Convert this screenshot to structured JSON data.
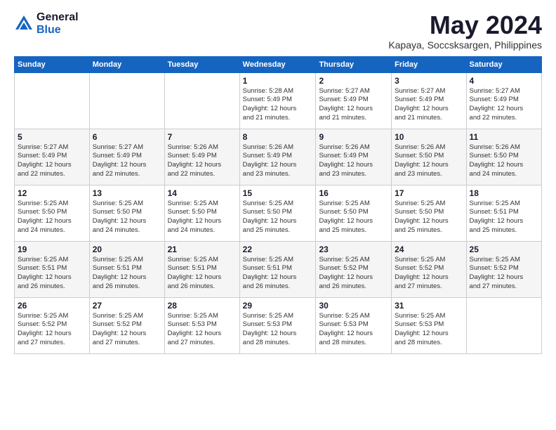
{
  "logo": {
    "general": "General",
    "blue": "Blue"
  },
  "header": {
    "title": "May 2024",
    "subtitle": "Kapaya, Soccsksargen, Philippines"
  },
  "weekdays": [
    "Sunday",
    "Monday",
    "Tuesday",
    "Wednesday",
    "Thursday",
    "Friday",
    "Saturday"
  ],
  "weeks": [
    [
      {
        "day": "",
        "info": ""
      },
      {
        "day": "",
        "info": ""
      },
      {
        "day": "",
        "info": ""
      },
      {
        "day": "1",
        "info": "Sunrise: 5:28 AM\nSunset: 5:49 PM\nDaylight: 12 hours\nand 21 minutes."
      },
      {
        "day": "2",
        "info": "Sunrise: 5:27 AM\nSunset: 5:49 PM\nDaylight: 12 hours\nand 21 minutes."
      },
      {
        "day": "3",
        "info": "Sunrise: 5:27 AM\nSunset: 5:49 PM\nDaylight: 12 hours\nand 21 minutes."
      },
      {
        "day": "4",
        "info": "Sunrise: 5:27 AM\nSunset: 5:49 PM\nDaylight: 12 hours\nand 22 minutes."
      }
    ],
    [
      {
        "day": "5",
        "info": "Sunrise: 5:27 AM\nSunset: 5:49 PM\nDaylight: 12 hours\nand 22 minutes."
      },
      {
        "day": "6",
        "info": "Sunrise: 5:27 AM\nSunset: 5:49 PM\nDaylight: 12 hours\nand 22 minutes."
      },
      {
        "day": "7",
        "info": "Sunrise: 5:26 AM\nSunset: 5:49 PM\nDaylight: 12 hours\nand 22 minutes."
      },
      {
        "day": "8",
        "info": "Sunrise: 5:26 AM\nSunset: 5:49 PM\nDaylight: 12 hours\nand 23 minutes."
      },
      {
        "day": "9",
        "info": "Sunrise: 5:26 AM\nSunset: 5:49 PM\nDaylight: 12 hours\nand 23 minutes."
      },
      {
        "day": "10",
        "info": "Sunrise: 5:26 AM\nSunset: 5:50 PM\nDaylight: 12 hours\nand 23 minutes."
      },
      {
        "day": "11",
        "info": "Sunrise: 5:26 AM\nSunset: 5:50 PM\nDaylight: 12 hours\nand 24 minutes."
      }
    ],
    [
      {
        "day": "12",
        "info": "Sunrise: 5:25 AM\nSunset: 5:50 PM\nDaylight: 12 hours\nand 24 minutes."
      },
      {
        "day": "13",
        "info": "Sunrise: 5:25 AM\nSunset: 5:50 PM\nDaylight: 12 hours\nand 24 minutes."
      },
      {
        "day": "14",
        "info": "Sunrise: 5:25 AM\nSunset: 5:50 PM\nDaylight: 12 hours\nand 24 minutes."
      },
      {
        "day": "15",
        "info": "Sunrise: 5:25 AM\nSunset: 5:50 PM\nDaylight: 12 hours\nand 25 minutes."
      },
      {
        "day": "16",
        "info": "Sunrise: 5:25 AM\nSunset: 5:50 PM\nDaylight: 12 hours\nand 25 minutes."
      },
      {
        "day": "17",
        "info": "Sunrise: 5:25 AM\nSunset: 5:50 PM\nDaylight: 12 hours\nand 25 minutes."
      },
      {
        "day": "18",
        "info": "Sunrise: 5:25 AM\nSunset: 5:51 PM\nDaylight: 12 hours\nand 25 minutes."
      }
    ],
    [
      {
        "day": "19",
        "info": "Sunrise: 5:25 AM\nSunset: 5:51 PM\nDaylight: 12 hours\nand 26 minutes."
      },
      {
        "day": "20",
        "info": "Sunrise: 5:25 AM\nSunset: 5:51 PM\nDaylight: 12 hours\nand 26 minutes."
      },
      {
        "day": "21",
        "info": "Sunrise: 5:25 AM\nSunset: 5:51 PM\nDaylight: 12 hours\nand 26 minutes."
      },
      {
        "day": "22",
        "info": "Sunrise: 5:25 AM\nSunset: 5:51 PM\nDaylight: 12 hours\nand 26 minutes."
      },
      {
        "day": "23",
        "info": "Sunrise: 5:25 AM\nSunset: 5:52 PM\nDaylight: 12 hours\nand 26 minutes."
      },
      {
        "day": "24",
        "info": "Sunrise: 5:25 AM\nSunset: 5:52 PM\nDaylight: 12 hours\nand 27 minutes."
      },
      {
        "day": "25",
        "info": "Sunrise: 5:25 AM\nSunset: 5:52 PM\nDaylight: 12 hours\nand 27 minutes."
      }
    ],
    [
      {
        "day": "26",
        "info": "Sunrise: 5:25 AM\nSunset: 5:52 PM\nDaylight: 12 hours\nand 27 minutes."
      },
      {
        "day": "27",
        "info": "Sunrise: 5:25 AM\nSunset: 5:52 PM\nDaylight: 12 hours\nand 27 minutes."
      },
      {
        "day": "28",
        "info": "Sunrise: 5:25 AM\nSunset: 5:53 PM\nDaylight: 12 hours\nand 27 minutes."
      },
      {
        "day": "29",
        "info": "Sunrise: 5:25 AM\nSunset: 5:53 PM\nDaylight: 12 hours\nand 28 minutes."
      },
      {
        "day": "30",
        "info": "Sunrise: 5:25 AM\nSunset: 5:53 PM\nDaylight: 12 hours\nand 28 minutes."
      },
      {
        "day": "31",
        "info": "Sunrise: 5:25 AM\nSunset: 5:53 PM\nDaylight: 12 hours\nand 28 minutes."
      },
      {
        "day": "",
        "info": ""
      }
    ]
  ]
}
